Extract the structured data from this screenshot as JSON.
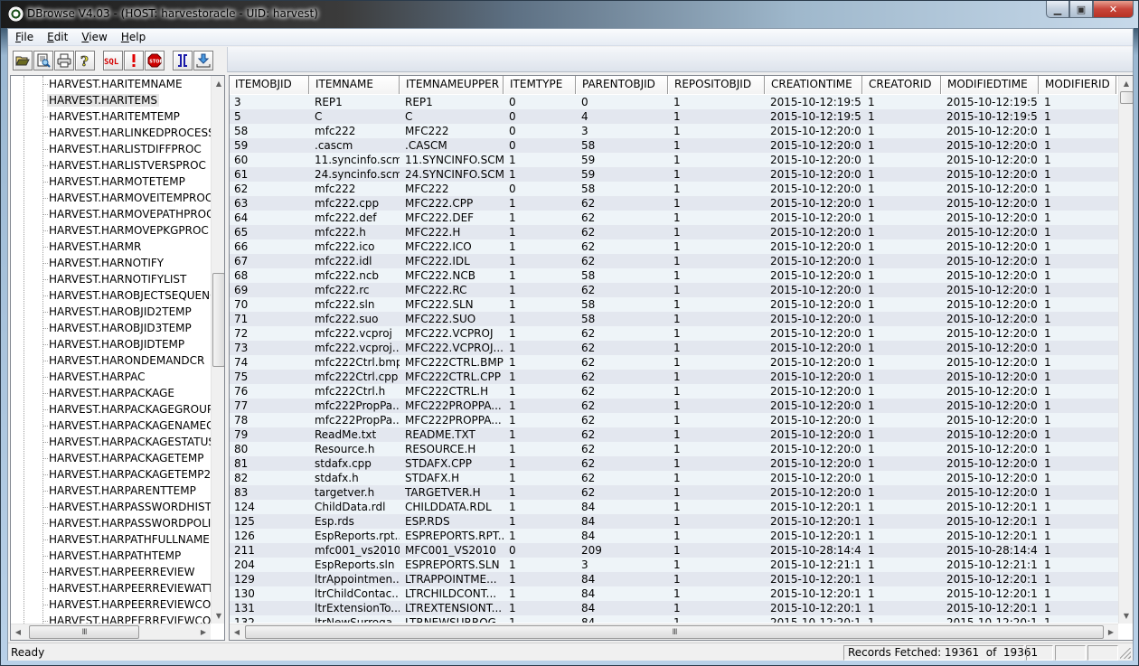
{
  "window": {
    "title": "DBrowse V4.03 - (HOST: harvestoracle -   UID: harvest)",
    "minimize_glyph": "▁",
    "maximize_glyph": "▣",
    "close_glyph": "✕"
  },
  "menubar": {
    "items": [
      {
        "label_u": "F",
        "label_rest": "ile"
      },
      {
        "label_u": "E",
        "label_rest": "dit"
      },
      {
        "label_u": "V",
        "label_rest": "iew"
      },
      {
        "label_u": "H",
        "label_rest": "elp"
      }
    ]
  },
  "toolbar": {
    "buttons": [
      {
        "name": "open-folder-icon",
        "label": "Open"
      },
      {
        "name": "print-preview-icon",
        "label": "Print Preview"
      },
      {
        "name": "printer-icon",
        "label": "Print"
      },
      {
        "name": "help-icon",
        "label": "?"
      },
      {
        "name": "sql-icon",
        "label": "SQL"
      },
      {
        "name": "execute-icon",
        "label": "!"
      },
      {
        "name": "stop-icon",
        "label": "STOP"
      },
      {
        "name": "columns-icon",
        "label": "]["
      },
      {
        "name": "download-icon",
        "label": "Export"
      }
    ],
    "colors": {
      "sql": "#d40000",
      "execute": "#e00000",
      "stop": "#cc0000",
      "columns": "#1a1aa8",
      "download": "#1a6ad0"
    }
  },
  "tree": {
    "selected_index": 1,
    "items": [
      "HARVEST.HARITEMNAME",
      "HARVEST.HARITEMS",
      "HARVEST.HARITEMTEMP",
      "HARVEST.HARLINKEDPROCESS",
      "HARVEST.HARLISTDIFFPROC",
      "HARVEST.HARLISTVERSPROC",
      "HARVEST.HARMOTETEMP",
      "HARVEST.HARMOVEITEMPROC",
      "HARVEST.HARMOVEPATHPROC",
      "HARVEST.HARMOVEPKGPROC",
      "HARVEST.HARMR",
      "HARVEST.HARNOTIFY",
      "HARVEST.HARNOTIFYLIST",
      "HARVEST.HAROBJECTSEQUENCEI",
      "HARVEST.HAROBJID2TEMP",
      "HARVEST.HAROBJID3TEMP",
      "HARVEST.HAROBJIDTEMP",
      "HARVEST.HARONDEMANDCR",
      "HARVEST.HARPAC",
      "HARVEST.HARPACKAGE",
      "HARVEST.HARPACKAGEGROUP",
      "HARVEST.HARPACKAGENAMEGEI",
      "HARVEST.HARPACKAGESTATUS",
      "HARVEST.HARPACKAGETEMP",
      "HARVEST.HARPACKAGETEMP2",
      "HARVEST.HARPARENTTEMP",
      "HARVEST.HARPASSWORDHISTOR",
      "HARVEST.HARPASSWORDPOLICY",
      "HARVEST.HARPATHFULLNAME",
      "HARVEST.HARPATHTEMP",
      "HARVEST.HARPEERREVIEW",
      "HARVEST.HARPEERREVIEWATTAC",
      "HARVEST.HARPEERREVIEWCOMM",
      "HARVEST.HARPEERREVIEWCOMM"
    ]
  },
  "grid": {
    "columns": [
      "ITEMOBJID",
      "ITEMNAME",
      "ITEMNAMEUPPER",
      "ITEMTYPE",
      "PARENTOBJID",
      "REPOSITOBJID",
      "CREATIONTIME",
      "CREATORID",
      "MODIFIEDTIME",
      "MODIFIERID"
    ],
    "rows": [
      [
        "3",
        "REP1",
        "REP1",
        "0",
        "0",
        "1",
        "2015-10-12:19:5...",
        "1",
        "2015-10-12:19:5...",
        "1"
      ],
      [
        "5",
        "C",
        "C",
        "0",
        "4",
        "1",
        "2015-10-12:19:5...",
        "1",
        "2015-10-12:19:5...",
        "1"
      ],
      [
        "58",
        "mfc222",
        "MFC222",
        "0",
        "3",
        "1",
        "2015-10-12:20:0...",
        "1",
        "2015-10-12:20:0...",
        "1"
      ],
      [
        "59",
        ".cascm",
        ".CASCM",
        "0",
        "58",
        "1",
        "2015-10-12:20:0...",
        "1",
        "2015-10-12:20:0...",
        "1"
      ],
      [
        "60",
        "11.syncinfo.scm",
        "11.SYNCINFO.SCM",
        "1",
        "59",
        "1",
        "2015-10-12:20:0...",
        "1",
        "2015-10-12:20:0...",
        "1"
      ],
      [
        "61",
        "24.syncinfo.scm",
        "24.SYNCINFO.SCM",
        "1",
        "59",
        "1",
        "2015-10-12:20:0...",
        "1",
        "2015-10-12:20:0...",
        "1"
      ],
      [
        "62",
        "mfc222",
        "MFC222",
        "0",
        "58",
        "1",
        "2015-10-12:20:0...",
        "1",
        "2015-10-12:20:0...",
        "1"
      ],
      [
        "63",
        "mfc222.cpp",
        "MFC222.CPP",
        "1",
        "62",
        "1",
        "2015-10-12:20:0...",
        "1",
        "2015-10-12:20:0...",
        "1"
      ],
      [
        "64",
        "mfc222.def",
        "MFC222.DEF",
        "1",
        "62",
        "1",
        "2015-10-12:20:0...",
        "1",
        "2015-10-12:20:0...",
        "1"
      ],
      [
        "65",
        "mfc222.h",
        "MFC222.H",
        "1",
        "62",
        "1",
        "2015-10-12:20:0...",
        "1",
        "2015-10-12:20:0...",
        "1"
      ],
      [
        "66",
        "mfc222.ico",
        "MFC222.ICO",
        "1",
        "62",
        "1",
        "2015-10-12:20:0...",
        "1",
        "2015-10-12:20:0...",
        "1"
      ],
      [
        "67",
        "mfc222.idl",
        "MFC222.IDL",
        "1",
        "62",
        "1",
        "2015-10-12:20:0...",
        "1",
        "2015-10-12:20:0...",
        "1"
      ],
      [
        "68",
        "mfc222.ncb",
        "MFC222.NCB",
        "1",
        "58",
        "1",
        "2015-10-12:20:0...",
        "1",
        "2015-10-12:20:0...",
        "1"
      ],
      [
        "69",
        "mfc222.rc",
        "MFC222.RC",
        "1",
        "62",
        "1",
        "2015-10-12:20:0...",
        "1",
        "2015-10-12:20:0...",
        "1"
      ],
      [
        "70",
        "mfc222.sln",
        "MFC222.SLN",
        "1",
        "58",
        "1",
        "2015-10-12:20:0...",
        "1",
        "2015-10-12:20:0...",
        "1"
      ],
      [
        "71",
        "mfc222.suo",
        "MFC222.SUO",
        "1",
        "58",
        "1",
        "2015-10-12:20:0...",
        "1",
        "2015-10-12:20:0...",
        "1"
      ],
      [
        "72",
        "mfc222.vcproj",
        "MFC222.VCPROJ",
        "1",
        "62",
        "1",
        "2015-10-12:20:0...",
        "1",
        "2015-10-12:20:0...",
        "1"
      ],
      [
        "73",
        "mfc222.vcproj....",
        "MFC222.VCPROJ....",
        "1",
        "62",
        "1",
        "2015-10-12:20:0...",
        "1",
        "2015-10-12:20:0...",
        "1"
      ],
      [
        "74",
        "mfc222Ctrl.bmp",
        "MFC222CTRL.BMP",
        "1",
        "62",
        "1",
        "2015-10-12:20:0...",
        "1",
        "2015-10-12:20:0...",
        "1"
      ],
      [
        "75",
        "mfc222Ctrl.cpp",
        "MFC222CTRL.CPP",
        "1",
        "62",
        "1",
        "2015-10-12:20:0...",
        "1",
        "2015-10-12:20:0...",
        "1"
      ],
      [
        "76",
        "mfc222Ctrl.h",
        "MFC222CTRL.H",
        "1",
        "62",
        "1",
        "2015-10-12:20:0...",
        "1",
        "2015-10-12:20:0...",
        "1"
      ],
      [
        "77",
        "mfc222PropPa...",
        "MFC222PROPPA...",
        "1",
        "62",
        "1",
        "2015-10-12:20:0...",
        "1",
        "2015-10-12:20:0...",
        "1"
      ],
      [
        "78",
        "mfc222PropPa...",
        "MFC222PROPPA...",
        "1",
        "62",
        "1",
        "2015-10-12:20:0...",
        "1",
        "2015-10-12:20:0...",
        "1"
      ],
      [
        "79",
        "ReadMe.txt",
        "README.TXT",
        "1",
        "62",
        "1",
        "2015-10-12:20:0...",
        "1",
        "2015-10-12:20:0...",
        "1"
      ],
      [
        "80",
        "Resource.h",
        "RESOURCE.H",
        "1",
        "62",
        "1",
        "2015-10-12:20:0...",
        "1",
        "2015-10-12:20:0...",
        "1"
      ],
      [
        "81",
        "stdafx.cpp",
        "STDAFX.CPP",
        "1",
        "62",
        "1",
        "2015-10-12:20:0...",
        "1",
        "2015-10-12:20:0...",
        "1"
      ],
      [
        "82",
        "stdafx.h",
        "STDAFX.H",
        "1",
        "62",
        "1",
        "2015-10-12:20:0...",
        "1",
        "2015-10-12:20:0...",
        "1"
      ],
      [
        "83",
        "targetver.h",
        "TARGETVER.H",
        "1",
        "62",
        "1",
        "2015-10-12:20:0...",
        "1",
        "2015-10-12:20:0...",
        "1"
      ],
      [
        "124",
        "ChildData.rdl",
        "CHILDDATA.RDL",
        "1",
        "84",
        "1",
        "2015-10-12:20:1...",
        "1",
        "2015-10-12:20:1...",
        "1"
      ],
      [
        "125",
        "Esp.rds",
        "ESP.RDS",
        "1",
        "84",
        "1",
        "2015-10-12:20:1...",
        "1",
        "2015-10-12:20:1...",
        "1"
      ],
      [
        "126",
        "EspReports.rpt...",
        "ESPREPORTS.RPT...",
        "1",
        "84",
        "1",
        "2015-10-12:20:1...",
        "1",
        "2015-10-12:20:1...",
        "1"
      ],
      [
        "211",
        "mfc001_vs2010",
        "MFC001_VS2010",
        "0",
        "209",
        "1",
        "2015-10-28:14:4...",
        "1",
        "2015-10-28:14:4...",
        "1"
      ],
      [
        "204",
        "EspReports.sln",
        "ESPREPORTS.SLN",
        "1",
        "3",
        "1",
        "2015-10-12:21:1...",
        "1",
        "2015-10-12:21:1...",
        "1"
      ],
      [
        "129",
        "ltrAppointmen...",
        "LTRAPPOINTME...",
        "1",
        "84",
        "1",
        "2015-10-12:20:1...",
        "1",
        "2015-10-12:20:1...",
        "1"
      ],
      [
        "130",
        "ltrChildContac...",
        "LTRCHILDCONT...",
        "1",
        "84",
        "1",
        "2015-10-12:20:1...",
        "1",
        "2015-10-12:20:1...",
        "1"
      ],
      [
        "131",
        "ltrExtensionTo...",
        "LTREXTENSIONT...",
        "1",
        "84",
        "1",
        "2015-10-12:20:1...",
        "1",
        "2015-10-12:20:1...",
        "1"
      ],
      [
        "132",
        "ltrNewSurroga...",
        "LTRNEWSURROG...",
        "1",
        "84",
        "1",
        "2015-10-12:20:1...",
        "1",
        "2015-10-12:20:1...",
        "1"
      ]
    ]
  },
  "scroll": {
    "up_arrow": "▲",
    "down_arrow": "▼",
    "left_arrow": "◀",
    "right_arrow": "▶",
    "grip": "III"
  },
  "statusbar": {
    "status": "Ready",
    "records": "Records Fetched: 19361  of  19361"
  }
}
